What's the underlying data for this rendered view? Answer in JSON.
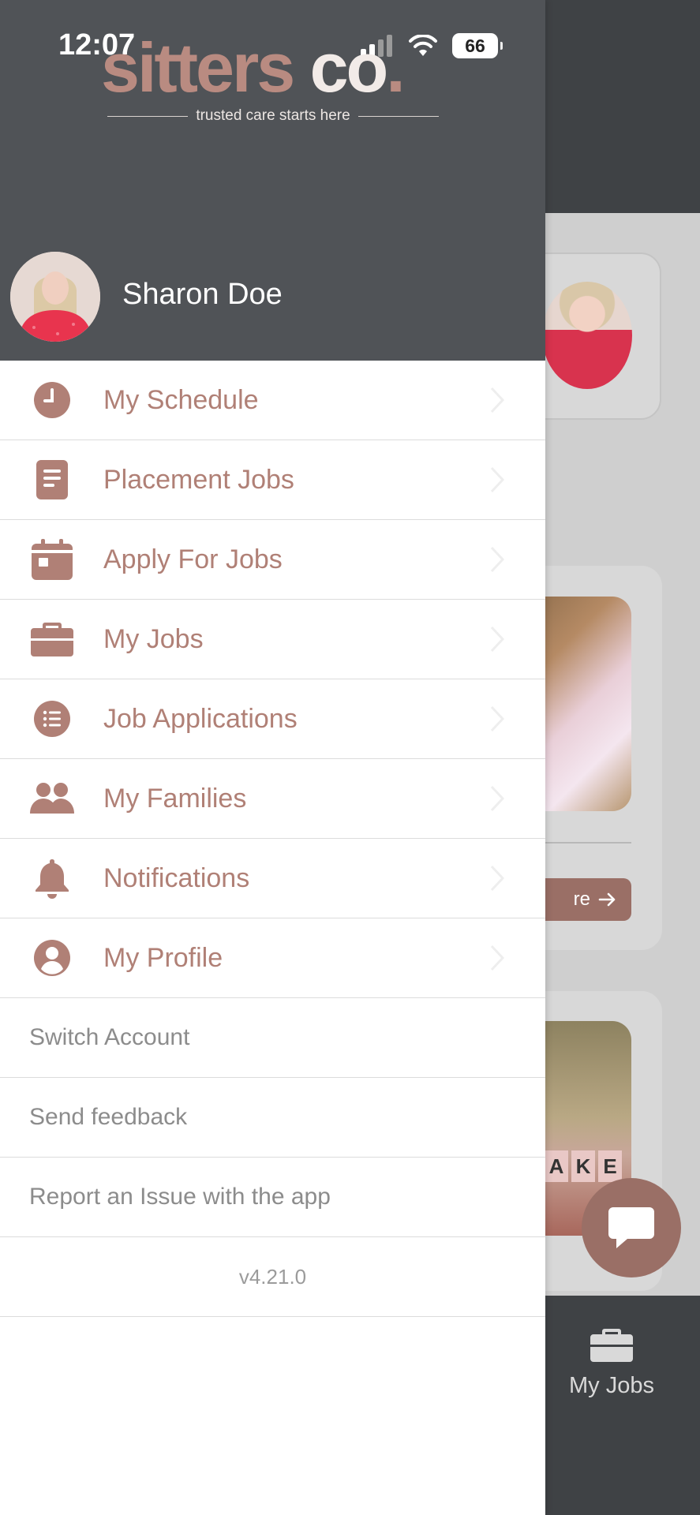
{
  "status_bar": {
    "time": "12:07",
    "battery": "66"
  },
  "brand": {
    "word1": "sitters",
    "word2": "co",
    "dot": ".",
    "tagline": "trusted care starts here"
  },
  "user": {
    "name": "Sharon Doe"
  },
  "menu": {
    "items": [
      {
        "label": "My Schedule",
        "icon": "clock-icon"
      },
      {
        "label": "Placement Jobs",
        "icon": "document-icon"
      },
      {
        "label": "Apply For Jobs",
        "icon": "calendar-icon"
      },
      {
        "label": "My Jobs",
        "icon": "briefcase-icon"
      },
      {
        "label": "Job Applications",
        "icon": "list-icon"
      },
      {
        "label": "My Families",
        "icon": "users-icon"
      },
      {
        "label": "Notifications",
        "icon": "bell-icon"
      },
      {
        "label": "My Profile",
        "icon": "user-circle-icon"
      }
    ],
    "secondary": [
      {
        "label": "Switch Account"
      },
      {
        "label": "Send feedback"
      },
      {
        "label": "Report an Issue with the app"
      }
    ],
    "version": "v4.21.0"
  },
  "background": {
    "more_button_label": "re",
    "tiles": [
      "A",
      "K",
      "E"
    ],
    "tab_label": "My Jobs"
  },
  "colors": {
    "accent": "#b08076",
    "drawer_header": "#505357",
    "button": "#9a6f66"
  }
}
